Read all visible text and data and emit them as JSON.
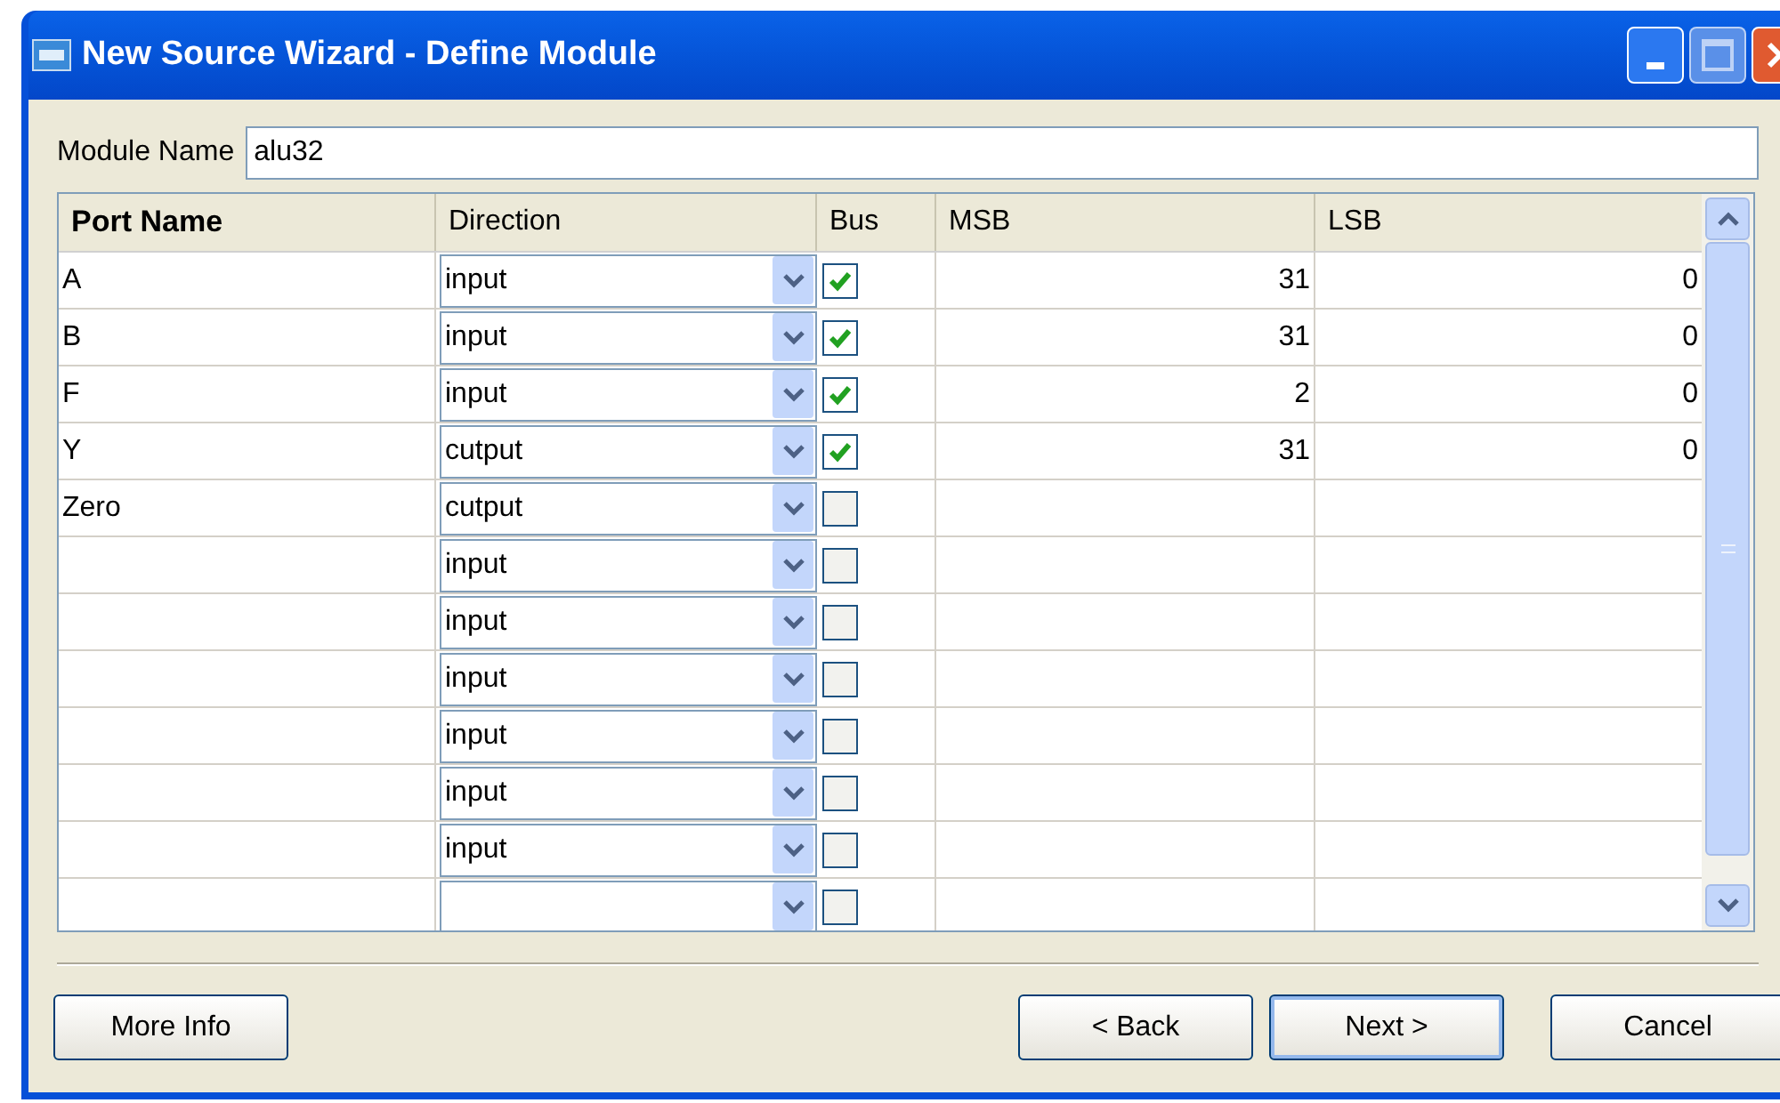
{
  "window": {
    "title": "New Source Wizard - Define Module"
  },
  "module_name": {
    "label": "Module Name",
    "value": "alu32"
  },
  "table": {
    "columns": [
      "Port Name",
      "Direction",
      "Bus",
      "MSB",
      "LSB"
    ],
    "rows": [
      {
        "port_name": "A",
        "direction": "input",
        "bus": true,
        "msb": "31",
        "lsb": "0"
      },
      {
        "port_name": "B",
        "direction": "input",
        "bus": true,
        "msb": "31",
        "lsb": "0"
      },
      {
        "port_name": "F",
        "direction": "input",
        "bus": true,
        "msb": "2",
        "lsb": "0"
      },
      {
        "port_name": "Y",
        "direction": "cutput",
        "bus": true,
        "msb": "31",
        "lsb": "0"
      },
      {
        "port_name": "Zero",
        "direction": "cutput",
        "bus": false
      },
      {
        "direction": "input",
        "bus": false
      },
      {
        "direction": "input",
        "bus": false
      },
      {
        "direction": "input",
        "bus": false
      },
      {
        "direction": "input",
        "bus": false
      },
      {
        "direction": "input",
        "bus": false
      },
      {
        "direction": "input",
        "bus": false
      },
      {
        "bus": false
      }
    ]
  },
  "buttons": {
    "left": [
      "More Info"
    ],
    "right": [
      "< Back",
      "Next >",
      "Cancel"
    ]
  }
}
